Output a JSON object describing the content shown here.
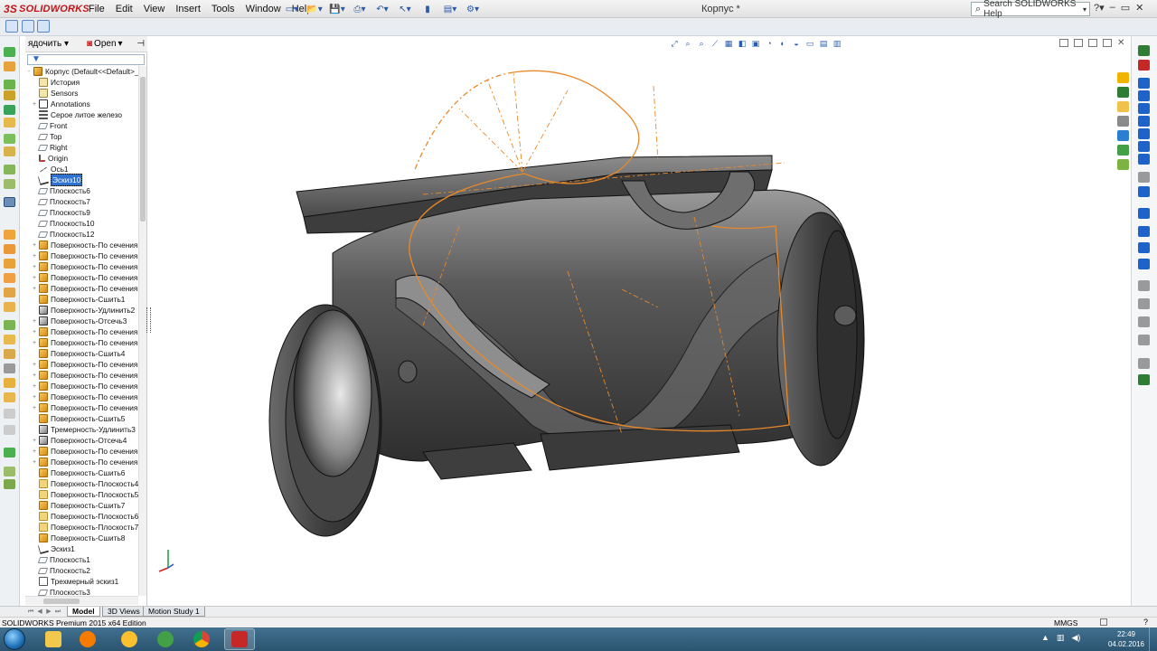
{
  "app": {
    "logo": "SOLIDWORKS",
    "logo_prefix": "3S",
    "menus": [
      "File",
      "Edit",
      "View",
      "Insert",
      "Tools",
      "Window",
      "Help"
    ],
    "doc_title": "Корпус *",
    "help_search_placeholder": "Search SOLIDWORKS Help"
  },
  "tree": {
    "toolbar_left": "ядочить",
    "open_label": "Open",
    "root": "Корпус  (Default<<Default>_D",
    "items": [
      {
        "label": "История",
        "icon": "hist",
        "exp": ""
      },
      {
        "label": "Sensors",
        "icon": "sens",
        "exp": ""
      },
      {
        "label": "Annotations",
        "icon": "ann",
        "exp": "+"
      },
      {
        "label": "Серое литое железо",
        "icon": "mat",
        "exp": ""
      },
      {
        "label": "Front",
        "icon": "plane",
        "exp": ""
      },
      {
        "label": "Top",
        "icon": "plane",
        "exp": ""
      },
      {
        "label": "Right",
        "icon": "plane",
        "exp": ""
      },
      {
        "label": "Origin",
        "icon": "origin",
        "exp": ""
      },
      {
        "label": "Ось1",
        "icon": "axis",
        "exp": ""
      },
      {
        "label": "Эскиз10",
        "icon": "sketch",
        "exp": "",
        "selected": true
      },
      {
        "label": "Плоскость6",
        "icon": "plane",
        "exp": ""
      },
      {
        "label": "Плоскость7",
        "icon": "plane",
        "exp": ""
      },
      {
        "label": "Плоскость9",
        "icon": "plane",
        "exp": ""
      },
      {
        "label": "Плоскость10",
        "icon": "plane",
        "exp": ""
      },
      {
        "label": "Плоскость12",
        "icon": "plane",
        "exp": ""
      },
      {
        "label": "Поверхность-По сечениям",
        "icon": "surf",
        "exp": "+"
      },
      {
        "label": "Поверхность-По сечениям",
        "icon": "surf",
        "exp": "+"
      },
      {
        "label": "Поверхность-По сечениям",
        "icon": "surf",
        "exp": "+"
      },
      {
        "label": "Поверхность-По сечениям",
        "icon": "surf",
        "exp": "+"
      },
      {
        "label": "Поверхность-По сечениям",
        "icon": "surf",
        "exp": "+"
      },
      {
        "label": "Поверхность-Сшить1",
        "icon": "surf",
        "exp": ""
      },
      {
        "label": "Поверхность-Удлинить2",
        "icon": "cut",
        "exp": ""
      },
      {
        "label": "Поверхность-Отсечь3",
        "icon": "cut",
        "exp": "+"
      },
      {
        "label": "Поверхность-По сечениям",
        "icon": "surf",
        "exp": "+"
      },
      {
        "label": "Поверхность-По сечениям",
        "icon": "surf",
        "exp": "+"
      },
      {
        "label": "Поверхность-Сшить4",
        "icon": "surf",
        "exp": ""
      },
      {
        "label": "Поверхность-По сечениям",
        "icon": "surf",
        "exp": "+"
      },
      {
        "label": "Поверхность-По сечениям",
        "icon": "surf",
        "exp": "+"
      },
      {
        "label": "Поверхность-По сечениям",
        "icon": "surf",
        "exp": "+"
      },
      {
        "label": "Поверхность-По сечениям",
        "icon": "surf",
        "exp": "+"
      },
      {
        "label": "Поверхность-По сечениям",
        "icon": "surf",
        "exp": "+"
      },
      {
        "label": "Поверхность-Сшить5",
        "icon": "surf",
        "exp": ""
      },
      {
        "label": "Тремерность-Удлинить3",
        "icon": "cut",
        "exp": ""
      },
      {
        "label": "Поверхность-Отсечь4",
        "icon": "cut",
        "exp": "+"
      },
      {
        "label": "Поверхность-По сечениям",
        "icon": "surf",
        "exp": "+"
      },
      {
        "label": "Поверхность-По сечениям",
        "icon": "surf",
        "exp": "+"
      },
      {
        "label": "Поверхность-Сшить6",
        "icon": "surf",
        "exp": ""
      },
      {
        "label": "Поверхность-Плоскость4",
        "icon": "folder",
        "exp": ""
      },
      {
        "label": "Поверхность-Плоскость5",
        "icon": "folder",
        "exp": ""
      },
      {
        "label": "Поверхность-Сшить7",
        "icon": "surf",
        "exp": ""
      },
      {
        "label": "Поверхность-Плоскость6",
        "icon": "folder",
        "exp": ""
      },
      {
        "label": "Поверхность-Плоскость7",
        "icon": "folder",
        "exp": ""
      },
      {
        "label": "Поверхность-Сшить8",
        "icon": "surf",
        "exp": ""
      },
      {
        "label": "Эскиз1",
        "icon": "sketch",
        "exp": ""
      },
      {
        "label": "Плоскость1",
        "icon": "plane",
        "exp": ""
      },
      {
        "label": "Плоскость2",
        "icon": "plane",
        "exp": ""
      },
      {
        "label": "Трехмерный эскиз1",
        "icon": "sk3d",
        "exp": ""
      },
      {
        "label": "Плоскость3",
        "icon": "plane",
        "exp": ""
      }
    ]
  },
  "tabs": [
    "Model",
    "3D Views",
    "Motion Study 1"
  ],
  "status": {
    "edition": "SOLIDWORKS Premium 2015 x64 Edition",
    "units": "MMGS",
    "help": "?"
  },
  "clock": {
    "time": "22:49",
    "date": "04.02.2016"
  },
  "colors": {
    "accent": "#2f72d0",
    "sketch": "#e8892a",
    "body": "#4a4a4a"
  }
}
